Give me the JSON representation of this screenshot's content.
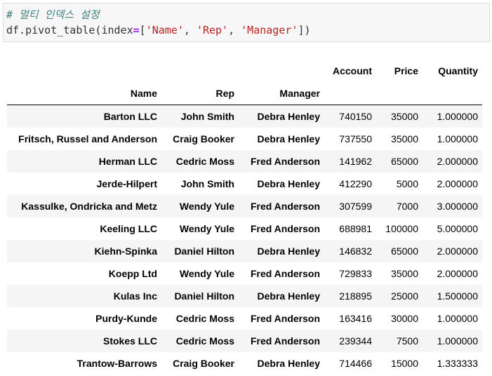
{
  "code": {
    "comment": "# 멀티 인덱스 설정",
    "line2": {
      "prefix": "df.pivot_table(index",
      "equals": "=",
      "open": "[",
      "items": [
        "'Name'",
        "'Rep'",
        "'Manager'"
      ],
      "sep": ", ",
      "close": "])"
    }
  },
  "table": {
    "index_names": [
      "Name",
      "Rep",
      "Manager"
    ],
    "columns": [
      "Account",
      "Price",
      "Quantity"
    ],
    "rows": [
      {
        "name": "Barton LLC",
        "rep": "John Smith",
        "manager": "Debra Henley",
        "account": "740150",
        "price": "35000",
        "quantity": "1.000000"
      },
      {
        "name": "Fritsch, Russel and Anderson",
        "rep": "Craig Booker",
        "manager": "Debra Henley",
        "account": "737550",
        "price": "35000",
        "quantity": "1.000000"
      },
      {
        "name": "Herman LLC",
        "rep": "Cedric Moss",
        "manager": "Fred Anderson",
        "account": "141962",
        "price": "65000",
        "quantity": "2.000000"
      },
      {
        "name": "Jerde-Hilpert",
        "rep": "John Smith",
        "manager": "Debra Henley",
        "account": "412290",
        "price": "5000",
        "quantity": "2.000000"
      },
      {
        "name": "Kassulke, Ondricka and Metz",
        "rep": "Wendy Yule",
        "manager": "Fred Anderson",
        "account": "307599",
        "price": "7000",
        "quantity": "3.000000"
      },
      {
        "name": "Keeling LLC",
        "rep": "Wendy Yule",
        "manager": "Fred Anderson",
        "account": "688981",
        "price": "100000",
        "quantity": "5.000000"
      },
      {
        "name": "Kiehn-Spinka",
        "rep": "Daniel Hilton",
        "manager": "Debra Henley",
        "account": "146832",
        "price": "65000",
        "quantity": "2.000000"
      },
      {
        "name": "Koepp Ltd",
        "rep": "Wendy Yule",
        "manager": "Fred Anderson",
        "account": "729833",
        "price": "35000",
        "quantity": "2.000000"
      },
      {
        "name": "Kulas Inc",
        "rep": "Daniel Hilton",
        "manager": "Debra Henley",
        "account": "218895",
        "price": "25000",
        "quantity": "1.500000"
      },
      {
        "name": "Purdy-Kunde",
        "rep": "Cedric Moss",
        "manager": "Fred Anderson",
        "account": "163416",
        "price": "30000",
        "quantity": "1.000000"
      },
      {
        "name": "Stokes LLC",
        "rep": "Cedric Moss",
        "manager": "Fred Anderson",
        "account": "239344",
        "price": "7500",
        "quantity": "1.000000"
      },
      {
        "name": "Trantow-Barrows",
        "rep": "Craig Booker",
        "manager": "Debra Henley",
        "account": "714466",
        "price": "15000",
        "quantity": "1.333333"
      }
    ]
  }
}
